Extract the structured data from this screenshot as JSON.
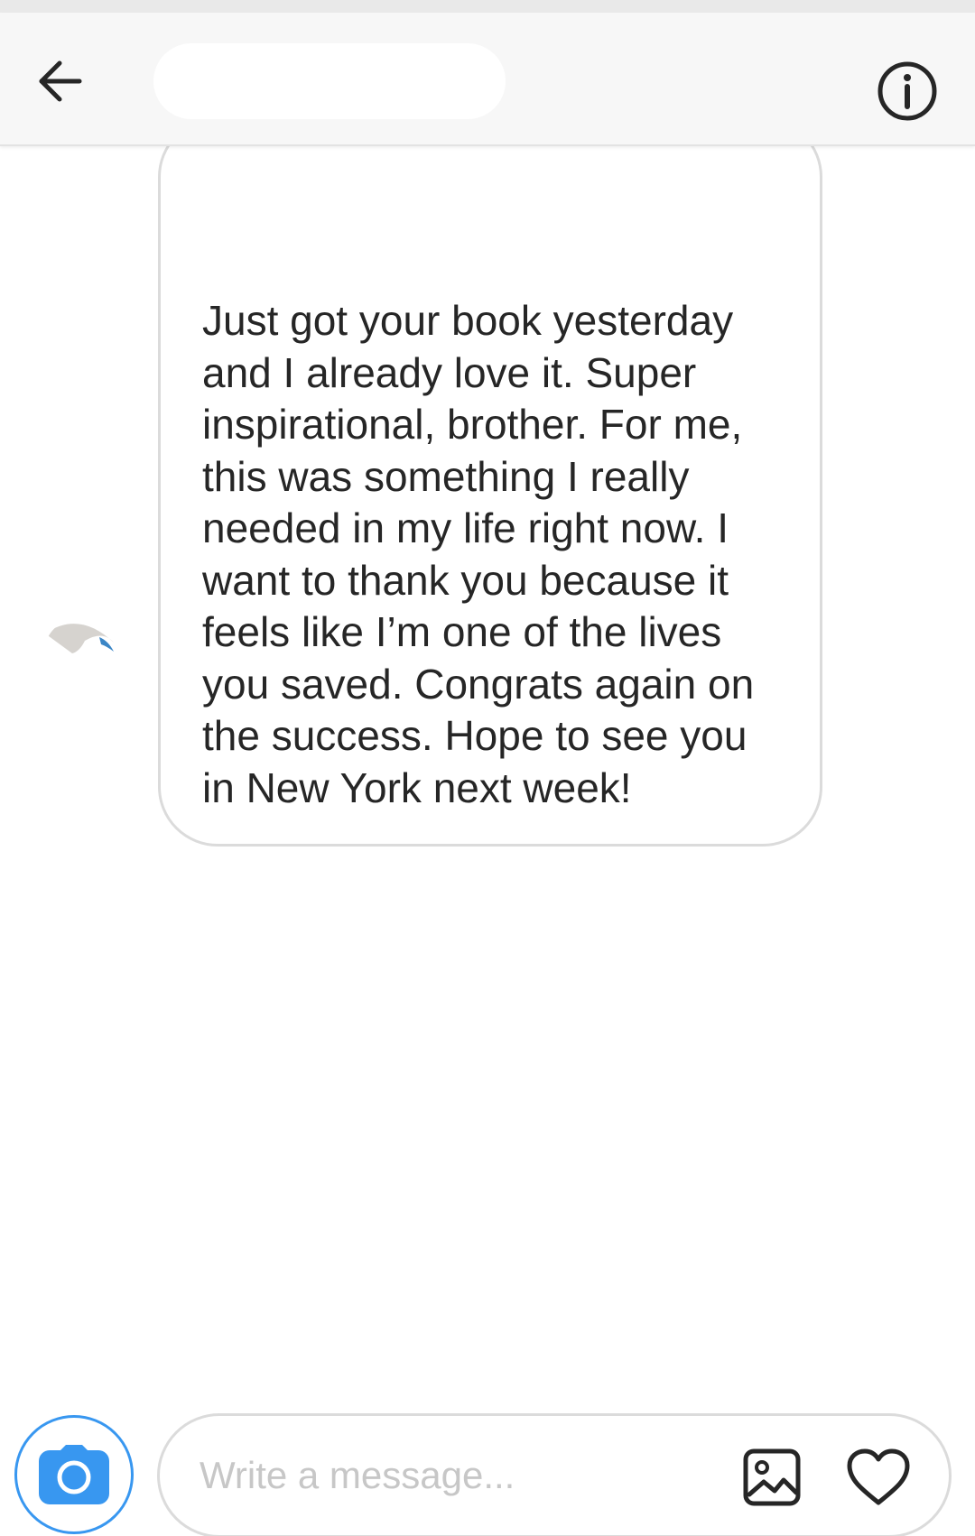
{
  "header": {
    "back_icon": "arrow-left-icon",
    "info_icon": "info-circle-icon",
    "username_redacted": true
  },
  "thread": {
    "messages": [
      {
        "direction": "incoming",
        "text": "Just got your book yesterday and I already love it. Super inspirational, brother. For me, this was something I really needed in my life right now. I want to thank you because it feels like I’m one of the lives you saved. Congrats again on the success. Hope to see you in New York next week!"
      }
    ]
  },
  "composer": {
    "placeholder": "Write a message...",
    "value": "",
    "camera_icon": "camera-icon",
    "gallery_icon": "image-gallery-icon",
    "like_icon": "heart-icon"
  },
  "colors": {
    "accent": "#3897f0",
    "header_bg": "#f7f7f7",
    "border": "#dbdbdb",
    "text": "#262626",
    "placeholder": "#c7c7c7"
  }
}
